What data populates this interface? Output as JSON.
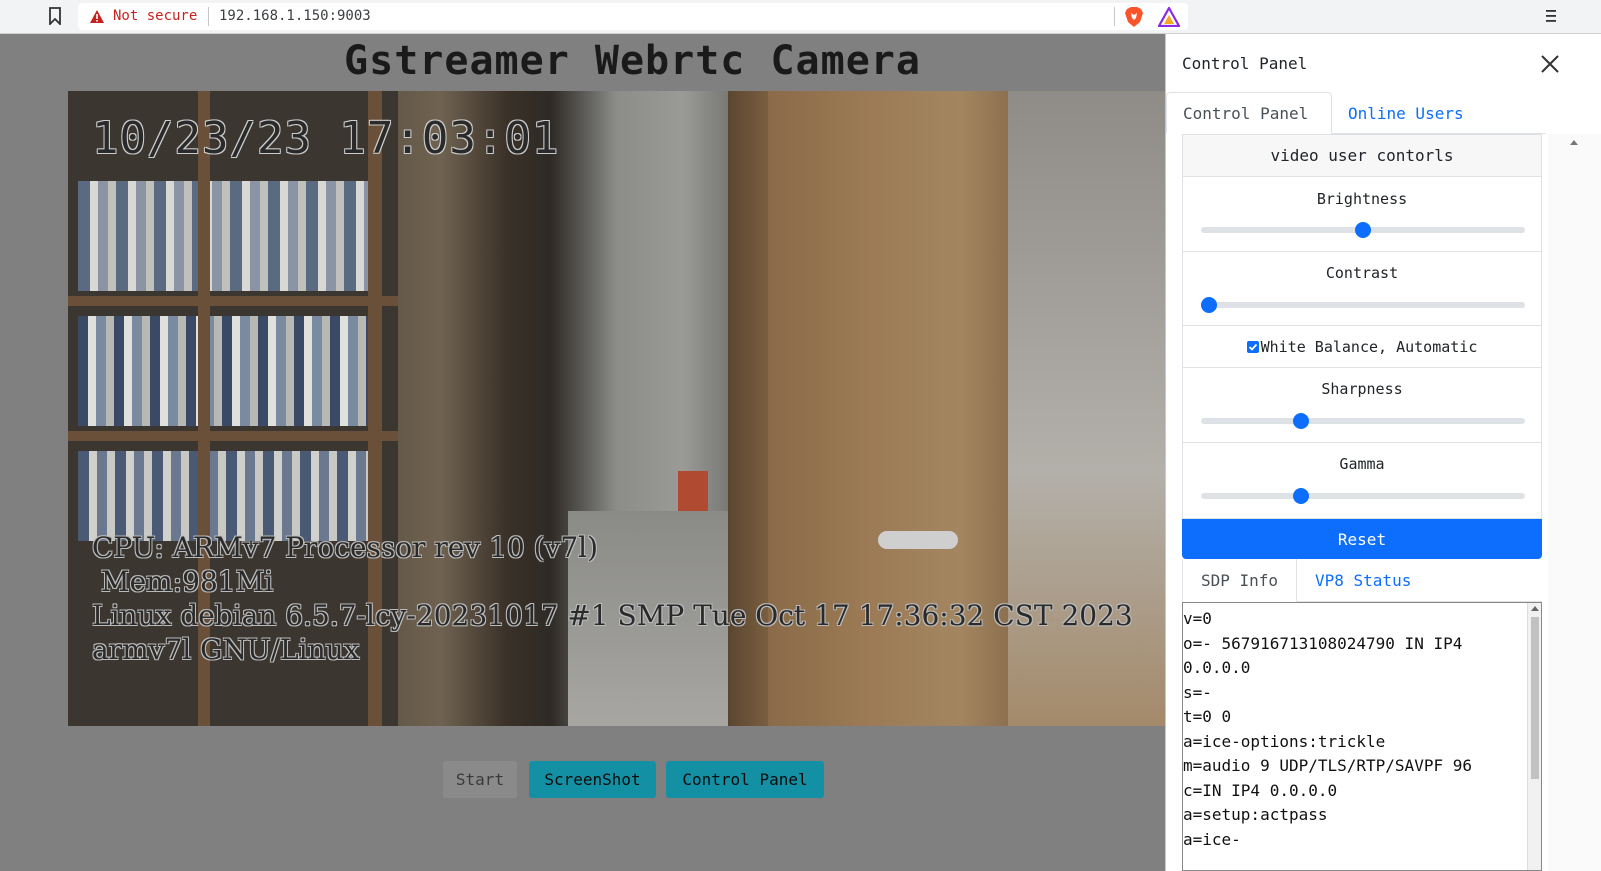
{
  "browser": {
    "security_label": "Not secure",
    "url": "192.168.1.150:9003"
  },
  "page": {
    "title": "Gstreamer Webrtc Camera",
    "overlay_datetime": "10/23/23 17:03:01",
    "overlay_info": "CPU: ARMv7 Processor rev 10 (v7l)\n Mem:981Mi\nLinux debian 6.5.7-lcy-20231017 #1 SMP Tue Oct 17 17:36:32 CST 2023\narmv7l GNU/Linux",
    "buttons": {
      "start": "Start",
      "screenshot": "ScreenShot",
      "control_panel": "Control Panel"
    }
  },
  "panel": {
    "title": "Control Panel",
    "tabs": [
      "Control Panel",
      "Online Users"
    ],
    "section_title": "video user contorls",
    "controls": {
      "brightness": {
        "label": "Brightness",
        "value_fraction": 0.5
      },
      "contrast": {
        "label": "Contrast",
        "value_fraction": 0.0
      },
      "white_balance": {
        "label": "White Balance, Automatic",
        "checked": true
      },
      "sharpness": {
        "label": "Sharpness",
        "value_fraction": 0.3
      },
      "gamma": {
        "label": "Gamma",
        "value_fraction": 0.3
      }
    },
    "reset_label": "Reset",
    "info_tabs": [
      "SDP Info",
      "VP8 Status"
    ],
    "sdp_text": "v=0\no=- 567916713108024790 IN IP4\n0.0.0.0\ns=-\nt=0 0\na=ice-options:trickle\nm=audio 9 UDP/TLS/RTP/SAVPF 96\nc=IN IP4 0.0.0.0\na=setup:actpass\na=ice-"
  },
  "colors": {
    "accent_blue": "#0d6efd",
    "teal_button": "#1390a4",
    "warning_red": "#c5221f"
  }
}
